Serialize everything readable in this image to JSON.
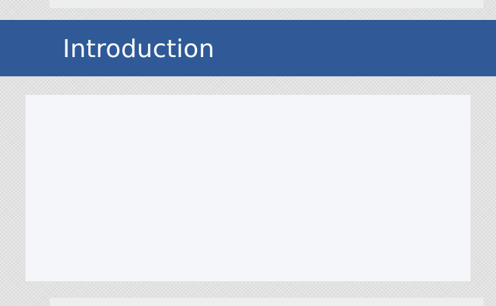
{
  "section": {
    "title": "Introduction"
  },
  "colors": {
    "header_background": "#2f5a97",
    "header_text": "#ffffff",
    "panel_background": "#f4f6f9",
    "page_background": "#dcdcdc"
  }
}
